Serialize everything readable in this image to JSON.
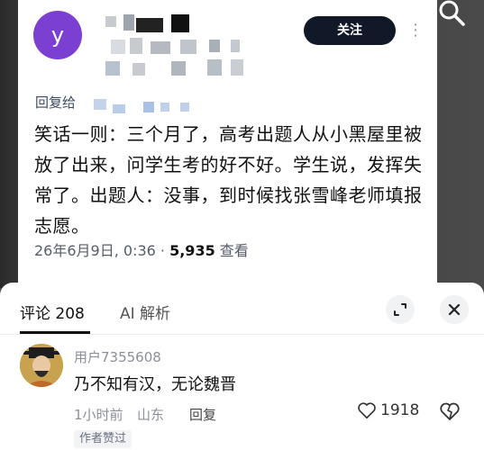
{
  "post": {
    "avatar_letter": "y",
    "follow_label": "关注",
    "more_label": "⋮",
    "reply_prefix": "回复给",
    "text": "笑话一则：三个月了，高考出题人从小黑屋里被放了出来，问学生考的好不好。学生说，发挥失常了。出题人：没事，到时候找张雪峰老师填报志愿。",
    "date_time": "26年6月9日, 0:36 · ",
    "views": "5,935",
    "views_label": " 查看",
    "avatar_color": "#7b3fd1"
  },
  "sheet": {
    "tab_comments": "评论 208",
    "tab_ai": "AI 解析"
  },
  "comment": {
    "username": "用户7355608",
    "text": "乃不知有汉，无论魏晋",
    "time": "1小时前",
    "location": "山东",
    "reply_label": "回复",
    "likes": "1918",
    "author_badge": "作者赞过"
  },
  "icons": {
    "search": "search-icon",
    "expand": "expand-icon",
    "close": "close-icon",
    "heart": "heart-icon",
    "broken_heart": "dislike-icon"
  }
}
